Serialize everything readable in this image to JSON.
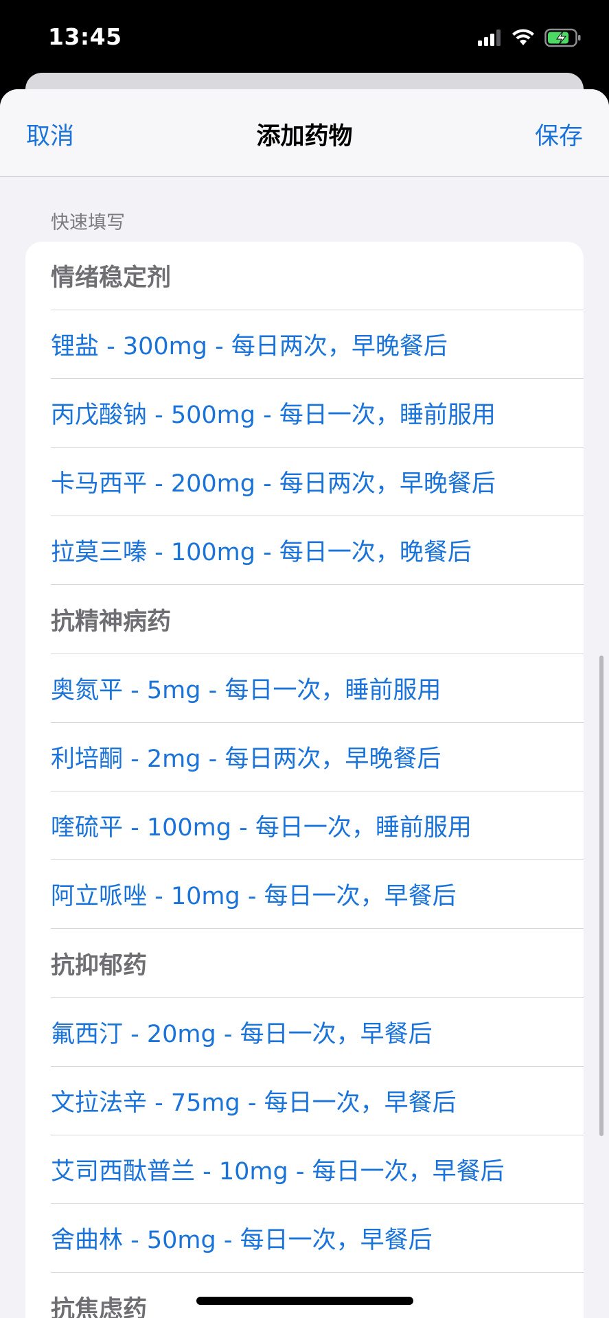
{
  "status_bar": {
    "time": "13:45",
    "icons": [
      "cellular-signal-icon",
      "wifi-icon",
      "battery-charging-icon"
    ],
    "battery_color": "#4cd964"
  },
  "nav": {
    "cancel_label": "取消",
    "title": "添加药物",
    "save_label": "保存"
  },
  "quick_fill": {
    "header": "快速填写",
    "groups": [
      {
        "title": "情绪稳定剂",
        "items": [
          "锂盐 - 300mg - 每日两次，早晚餐后",
          "丙戊酸钠 - 500mg - 每日一次，睡前服用",
          "卡马西平 - 200mg - 每日两次，早晚餐后",
          "拉莫三嗪 - 100mg - 每日一次，晚餐后"
        ]
      },
      {
        "title": "抗精神病药",
        "items": [
          "奥氮平 - 5mg - 每日一次，睡前服用",
          "利培酮 - 2mg - 每日两次，早晚餐后",
          "喹硫平 - 100mg - 每日一次，睡前服用",
          "阿立哌唑 - 10mg - 每日一次，早餐后"
        ]
      },
      {
        "title": "抗抑郁药",
        "items": [
          "氟西汀 - 20mg - 每日一次，早餐后",
          "文拉法辛 - 75mg - 每日一次，早餐后",
          "艾司西酞普兰 - 10mg - 每日一次，早餐后",
          "舍曲林 - 50mg - 每日一次，早餐后"
        ]
      },
      {
        "title": "抗焦虑药",
        "items": []
      }
    ]
  },
  "colors": {
    "accent": "#1a73d9",
    "group_title": "#6f6f73",
    "background": "#f2f2f7"
  }
}
